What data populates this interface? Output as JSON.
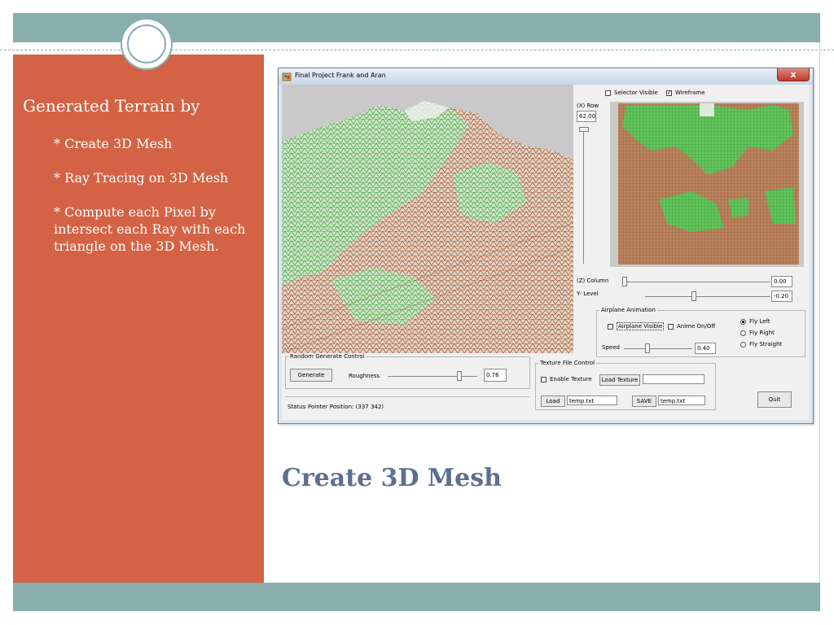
{
  "slide": {
    "heading": "Generated Terrain by",
    "bullets": [
      "* Create 3D Mesh",
      "* Ray Tracing on 3D Mesh",
      "* Compute each Pixel by intersect each Ray with each triangle on the 3D Mesh."
    ],
    "title": "Create 3D Mesh"
  },
  "colors": {
    "band": "#88aeae",
    "left_panel": "#d46345",
    "title_text": "#5c6f8f",
    "terrain_green": "#3fa83a",
    "terrain_brown": "#a0522d"
  },
  "window": {
    "title": "Final Project Frank and Aran",
    "close_label": "x"
  },
  "controls": {
    "selector_visible_label": "Selector Visible",
    "selector_visible_checked": false,
    "wireframe_label": "Wireframe",
    "wireframe_checked": true,
    "x_row_label": "(X) Row",
    "x_row_value": "62.00",
    "z_column_label": "(Z) Column",
    "z_column_value": "0.00",
    "y_level_label": "Y- Level",
    "y_level_value": "-0.20"
  },
  "airplane": {
    "group_label": "Airplane Animation",
    "visible_label": "Airplane Visible",
    "visible_checked": false,
    "anime_label": "Anime On/Off",
    "anime_checked": false,
    "speed_label": "Speed",
    "speed_value": "0.40",
    "directions": [
      "Fly Left",
      "Fly Right",
      "Fly Straight"
    ],
    "selected_direction": "Fly Left"
  },
  "random_gen": {
    "group_label": "Random Generate Control",
    "generate_label": "Generate",
    "roughness_label": "Roughness",
    "roughness_value": "0.76"
  },
  "texture": {
    "group_label": "Texture File Control",
    "enable_label": "Enable Texture",
    "enable_checked": false,
    "load_texture_label": "Load Texture",
    "texture_path": "",
    "load_label": "Load",
    "load_file": "temp.txt",
    "save_label": "SAVE",
    "save_file": "temp.txt"
  },
  "status": {
    "label": "Status",
    "text": "Pointer Position: (337 342)"
  },
  "quit_label": "Quit",
  "icons": {
    "app": "app-icon",
    "close": "close-icon"
  }
}
